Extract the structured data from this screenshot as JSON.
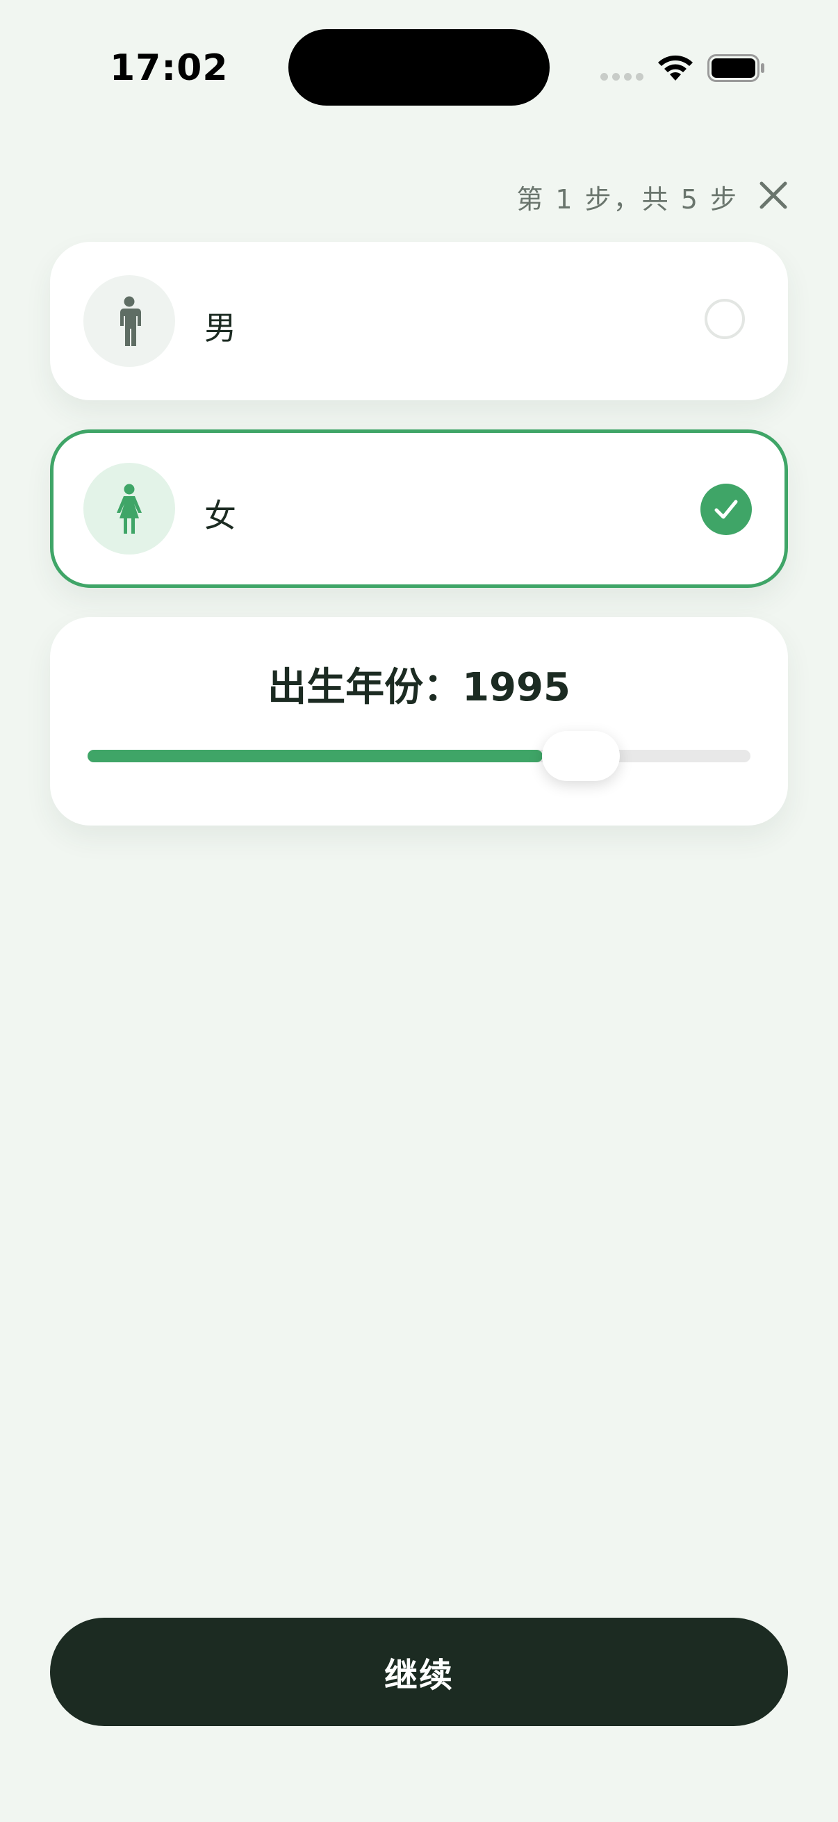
{
  "status_bar": {
    "time": "17:02",
    "icons": [
      "signal-icon",
      "wifi-icon",
      "battery-icon"
    ]
  },
  "header": {
    "step_text": "第 1 步，共 5 步",
    "close_icon": "close-icon"
  },
  "gender_options": [
    {
      "label": "男",
      "icon": "male-person-icon",
      "selected": false
    },
    {
      "label": "女",
      "icon": "female-person-icon",
      "selected": true
    }
  ],
  "birth_year": {
    "label": "出生年份：1995",
    "value": 1995,
    "slider_fraction": 0.735
  },
  "continue_button": {
    "label": "继续"
  },
  "colors": {
    "accent": "#3fa567",
    "background": "#f1f6f1",
    "dark": "#1c2b22"
  }
}
